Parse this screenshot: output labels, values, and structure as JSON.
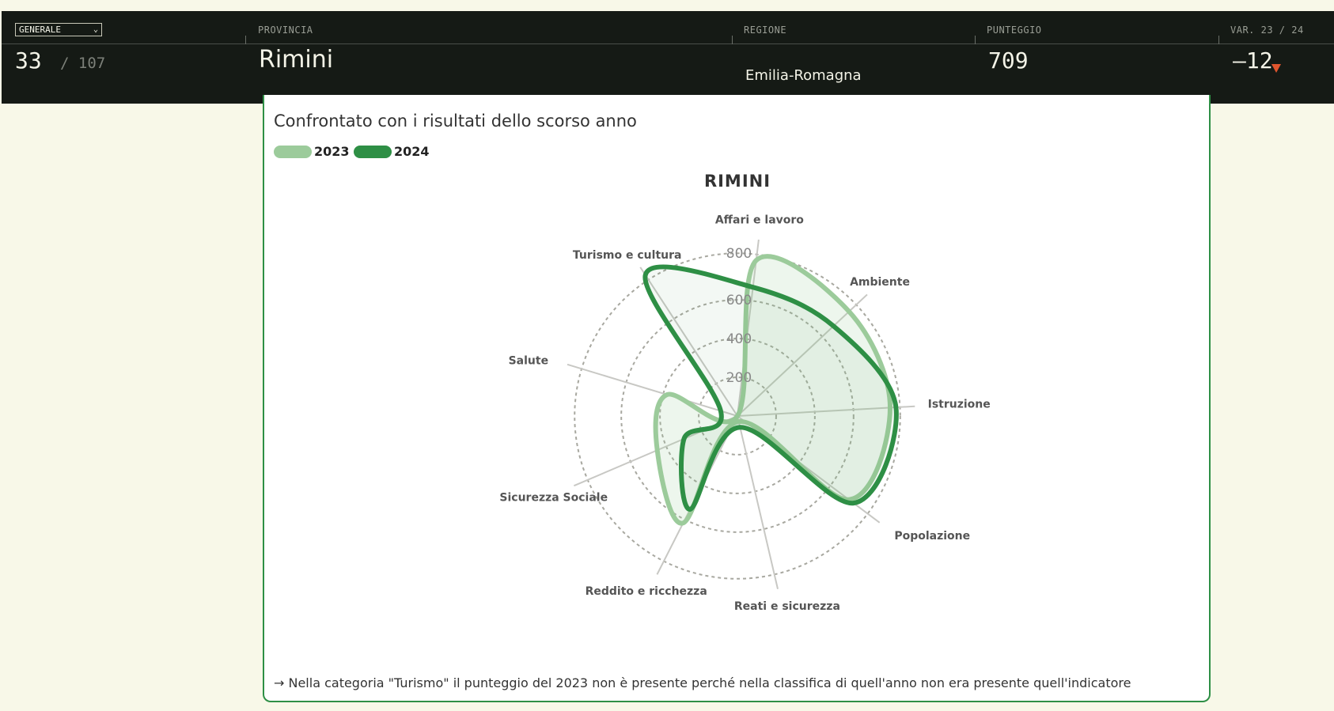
{
  "header": {
    "filter": {
      "value": "GENERALE"
    },
    "columns": [
      "PROVINCIA",
      "REGIONE",
      "PUNTEGGIO",
      "VAR. 23 / 24"
    ],
    "rank": "33",
    "rank_total": "/ 107",
    "province": "Rimini",
    "region": "Emilia-Romagna",
    "score": "709",
    "variation": "–12",
    "variation_direction": "down",
    "variation_color": "#e0552e"
  },
  "card": {
    "title": "Confrontato con i risultati dello scorso anno",
    "note": "→ Nella categoria \"Turismo\" il punteggio del 2023 non è presente perché nella classifica di quell'anno non era presente quell'indicatore"
  },
  "chart_data": {
    "type": "radar",
    "title": "RIMINI",
    "axes": [
      "Affari e lavoro",
      "Ambiente",
      "Istruzione",
      "Popolazione",
      "Reati e sicurezza",
      "Reddito e ricchezza",
      "Sicurezza Sociale",
      "Salute",
      "Turismo e cultura"
    ],
    "radial_ticks": [
      200,
      400,
      600,
      800
    ],
    "rmax": 850,
    "grid": true,
    "legend_placement": "top-left",
    "series": [
      {
        "name": "2023",
        "color": "#9ccb9b",
        "values": [
          810,
          790,
          790,
          720,
          30,
          620,
          450,
          380,
          0
        ]
      },
      {
        "name": "2024",
        "color": "#2e8f45",
        "values": [
          670,
          680,
          820,
          750,
          60,
          540,
          300,
          90,
          870
        ]
      }
    ]
  }
}
